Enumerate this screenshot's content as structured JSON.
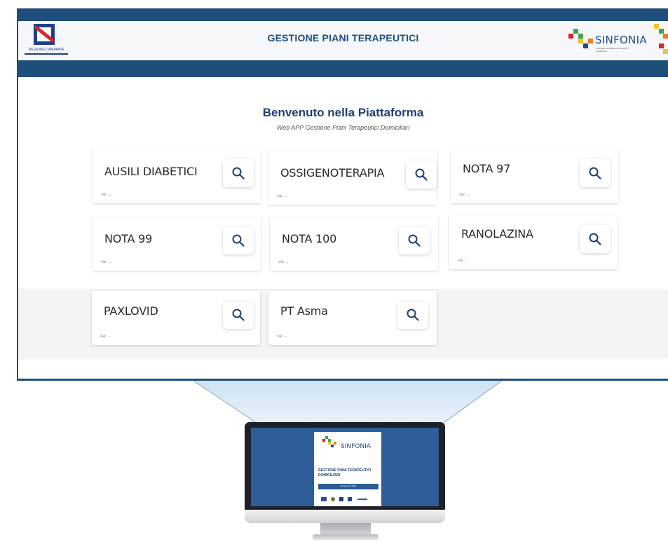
{
  "header": {
    "region_logo_caption": "REGIONE CAMPANIA",
    "title": "GESTIONE PIANI TERAPEUTICI",
    "brand": "SINFONIA",
    "brand_subtitle": "SISTEMA INFORMATIVO SANITÀ CAMPANIA"
  },
  "welcome": {
    "title": "Benvenuto nella Piattaforma",
    "subtitle": "Web APP Gestione Piani Terapeutici Domiciliari"
  },
  "cards": [
    {
      "title": "AUSILI DIABETICI",
      "more": "vai →",
      "icon": "search-icon"
    },
    {
      "title": "OSSIGENOTERAPIA",
      "more": "vai →",
      "icon": "search-icon"
    },
    {
      "title": "NOTA 97",
      "more": "vai →",
      "icon": "search-icon"
    },
    {
      "title": "NOTA 99",
      "more": "vai →",
      "icon": "search-icon"
    },
    {
      "title": "NOTA 100",
      "more": "vai →",
      "icon": "search-icon"
    },
    {
      "title": "RANOLAZINA",
      "more": "vai →",
      "icon": "search-icon"
    },
    {
      "title": "PAXLOVID",
      "more": "vai →",
      "icon": "search-icon"
    },
    {
      "title": "PT Asma",
      "more": "vai →",
      "icon": "search-icon"
    }
  ],
  "monitor": {
    "brand": "SINFONIA",
    "heading": "GESTIONE PIANI TERAPEUTICI DOMICILIARI",
    "login_button": "Accedi con SPID"
  },
  "colors": {
    "primary_blue": "#1d4f7a",
    "title_blue": "#1e4d84",
    "brand_red": "#d6262b",
    "brand_green": "#3aa84a",
    "brand_yellow": "#f2c230",
    "brand_orange": "#f07a1e"
  }
}
